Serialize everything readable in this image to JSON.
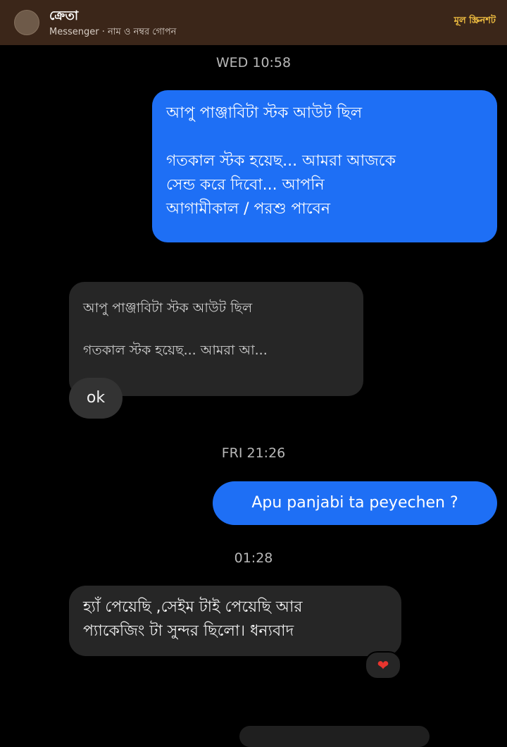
{
  "header": {
    "contact_name": "ক্রেতা",
    "subtitle": "Messenger · নাম ও নম্বর গোপন",
    "badge": "মূল স্ক্রিনশট"
  },
  "thread": {
    "ts1": "WED 10:58",
    "msg1_line1": "আপু পাঞ্জাবিটা স্টক আউট ছিল",
    "msg1_line2": "গতকাল স্টক হয়েছ... আমরা আজকে",
    "msg1_line3": "সেন্ড করে দিবো... আপনি",
    "msg1_line4": "আগামীকাল / পরশু পাবেন",
    "reply_quote_line1": "আপু পাঞ্জাবিটা স্টক আউট ছিল",
    "reply_quote_line2": "গতকাল স্টক হয়েছ... আমরা আ...",
    "reply_text": "ok",
    "ts2": "FRI 21:26",
    "msg3": "Apu panjabi ta peyechen ?",
    "ts3": "01:28",
    "msg4_line1": "হ্যাঁ পেয়েছি ,সেইম টাই পেয়েছি আর",
    "msg4_line2": "প্যাকেজিং টা সুন্দর ছিলো। ধন্যবাদ",
    "reaction": "❤"
  },
  "colors": {
    "header_bg": "#3b2619",
    "outgoing_bubble": "#1e6ff5",
    "incoming_bubble": "#262626",
    "badge_text": "#f6c342"
  }
}
